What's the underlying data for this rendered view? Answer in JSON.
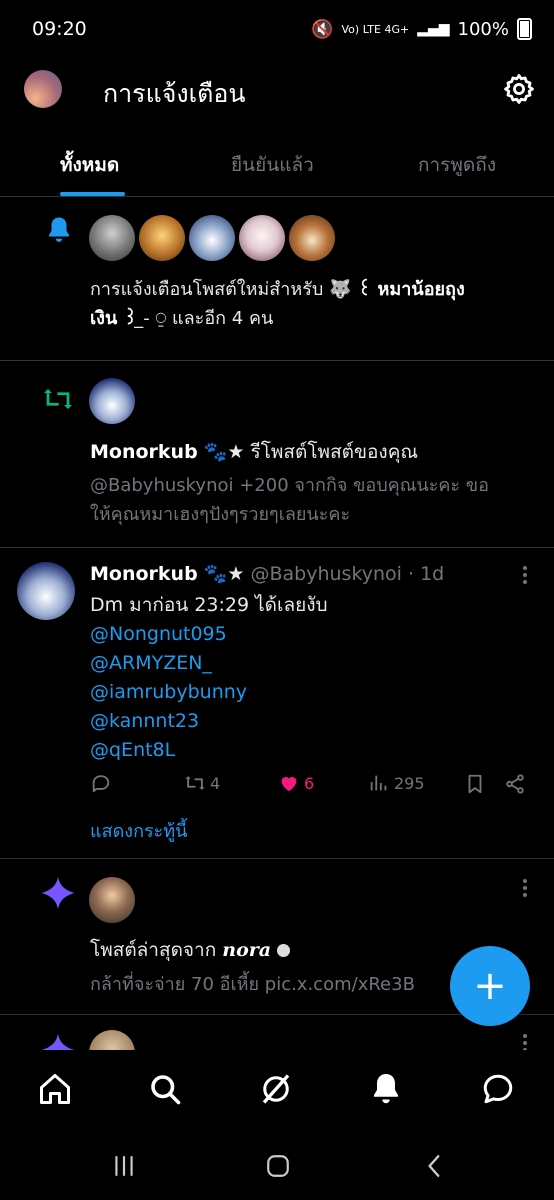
{
  "status_bar": {
    "time": "09:20",
    "network": "Vo) LTE 4G+",
    "battery": "100%"
  },
  "header": {
    "title": "การแจ้งเตือน",
    "settings_icon": "gear-icon"
  },
  "tabs": [
    {
      "label": "ทั้งหมด",
      "active": true
    },
    {
      "label": "ยืนยันแล้ว",
      "active": false
    },
    {
      "label": "การพูดถึง",
      "active": false
    }
  ],
  "colors": {
    "accent": "#1d9bf0",
    "like": "#f91880",
    "repost": "#00ba7c",
    "star": "#7856ff",
    "muted": "#71767b"
  },
  "notifications": [
    {
      "icon": "bell-icon",
      "line1_prefix": "การแจ้งเตือนโพสต์ใหม่สำหรับ 🐺",
      "line1_bold": "꒰ หมาน้อยถุง",
      "line2_bold": "เงิน ꒱",
      "line2_suffix": " ̲- ⍜ และอีก 4 คน"
    },
    {
      "icon": "repost-icon",
      "name": "Monorkub",
      "emoji": "🐾★",
      "action": "รีโพสต์โพสต์ของคุณ",
      "preview_line1": "@Babyhuskynoi +200 จากกิจ ขอบคุณนะคะ ขอ",
      "preview_line2": "ให้คุณหมาเฮงๆปังๆรวยๆเลยนะคะ"
    }
  ],
  "tweet": {
    "name": "Monorkub",
    "emoji": "🐾★",
    "handle": "@Babyhuskynoi",
    "time": "· 1d",
    "text": "Dm มาก่อน 23:29 ได้เลยงับ",
    "mentions": [
      "@Nongnut095",
      "@ARMYZEN_",
      "@iamrubybunny",
      "@kannnt23",
      "@qEnt8L"
    ],
    "reposts": "4",
    "likes": "6",
    "views": "295",
    "show_thread": "แสดงกระทู้นี้"
  },
  "recent_post": {
    "icon": "sparkle-icon",
    "prefix": "โพสต์ล่าสุดจาก ",
    "name": "nora",
    "preview": "กล้าที่จะจ่าย 70 อีเหี้ย pic.x.com/xRe3B"
  },
  "fab_label": "+"
}
